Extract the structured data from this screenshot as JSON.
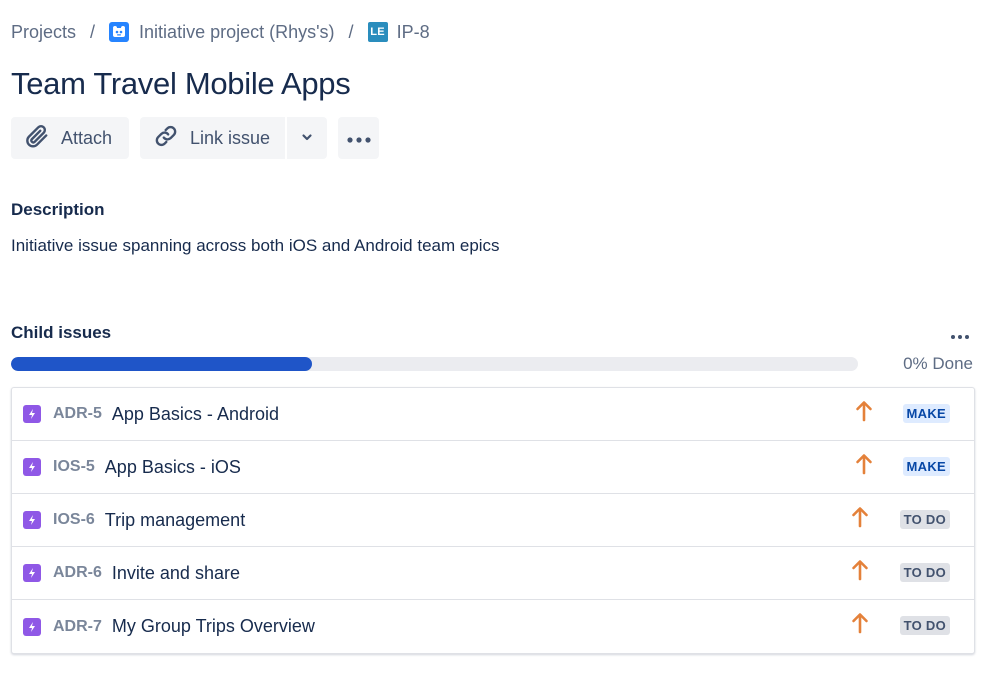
{
  "breadcrumb": {
    "projects": "Projects",
    "separator": "/",
    "project_name": "Initiative project (Rhys's)",
    "project_icon": "project-avatar-icon",
    "issue_type_badge": "LE",
    "issue_key": "IP-8"
  },
  "issue": {
    "title": "Team Travel Mobile Apps"
  },
  "toolbar": {
    "attach_label": "Attach",
    "link_issue_label": "Link issue"
  },
  "description": {
    "heading": "Description",
    "text": "Initiative issue spanning across both iOS and Android team epics"
  },
  "child_issues": {
    "heading": "Child issues",
    "progress_fraction": 0.355,
    "progress_label": "0% Done",
    "items": [
      {
        "key": "ADR-5",
        "summary": "App Basics - Android",
        "status": "MAKE",
        "priority": "high-priority-icon"
      },
      {
        "key": "IOS-5",
        "summary": "App Basics - iOS",
        "status": "MAKE",
        "priority": "high-priority-icon"
      },
      {
        "key": "IOS-6",
        "summary": "Trip management",
        "status": "TO DO",
        "priority": "high-priority-icon"
      },
      {
        "key": "ADR-6",
        "summary": "Invite and share",
        "status": "TO DO",
        "priority": "high-priority-icon"
      },
      {
        "key": "ADR-7",
        "summary": "My Group Trips Overview",
        "status": "TO DO",
        "priority": "high-priority-icon"
      }
    ]
  },
  "colors": {
    "progress_fill": "#1f55c8",
    "epic": "#8f58e6",
    "priority_high": "#e4813a",
    "status_make_bg": "#deebff",
    "status_todo_bg": "#dfe1e6"
  }
}
